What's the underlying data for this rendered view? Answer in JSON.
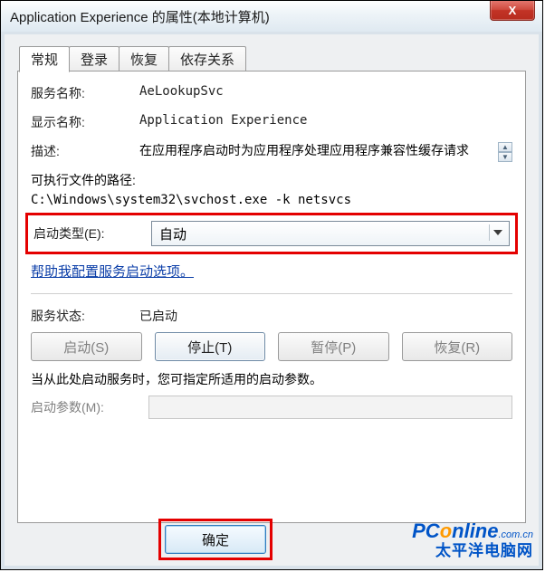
{
  "window": {
    "title": "Application Experience 的属性(本地计算机)",
    "close_glyph": "X"
  },
  "tabs": [
    {
      "label": "常规",
      "active": true
    },
    {
      "label": "登录",
      "active": false
    },
    {
      "label": "恢复",
      "active": false
    },
    {
      "label": "依存关系",
      "active": false
    }
  ],
  "fields": {
    "service_name_label": "服务名称:",
    "service_name_value": "AeLookupSvc",
    "display_name_label": "显示名称:",
    "display_name_value": "Application Experience",
    "description_label": "描述:",
    "description_value": "在应用程序启动时为应用程序处理应用程序兼容性缓存请求",
    "exe_path_label": "可执行文件的路径:",
    "exe_path_value": "C:\\Windows\\system32\\svchost.exe -k netsvcs",
    "startup_type_label": "启动类型(E):",
    "startup_type_value": "自动",
    "help_link": "帮助我配置服务启动选项。",
    "status_label": "服务状态:",
    "status_value": "已启动",
    "note_text": "当从此处启动服务时，您可指定所适用的启动参数。",
    "params_label": "启动参数(M):"
  },
  "buttons": {
    "start": "启动(S)",
    "stop": "停止(T)",
    "pause": "暂停(P)",
    "resume": "恢复(R)",
    "ok": "确定"
  },
  "watermark": {
    "line1_a": "PC",
    "line1_b": "o",
    "line1_c": "nline",
    "line1_suffix": ".com.cn",
    "line2": "太平洋电脑网"
  }
}
